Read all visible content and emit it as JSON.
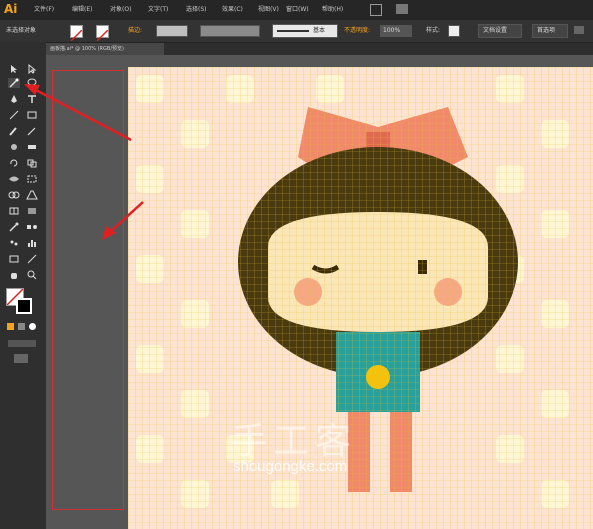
{
  "app": {
    "logo": "Ai",
    "accent": "#f7a21c"
  },
  "menu": [
    "文件(F)",
    "编辑(E)",
    "对象(O)",
    "文字(T)",
    "选择(S)",
    "效果(C)",
    "视图(V)",
    "窗口(W)",
    "帮助(H)"
  ],
  "control_bar": {
    "selection_label": "未选择对象",
    "stroke_label": "描边:",
    "style_label": "基本",
    "opacity_label": "不透明度:",
    "opacity_value": "100%",
    "style_field": "样式:",
    "doc_setup_button": "文档设置",
    "prefs_button": "首选项"
  },
  "document_tab": {
    "label": "画板描.ai* @ 100% (RGB/预览)"
  },
  "watermark": {
    "title": "手工客",
    "url": "shougongke.com"
  },
  "colors": {
    "fill": "#ffffff",
    "stroke": "#000000",
    "annotation_arrow": "#e02020"
  }
}
